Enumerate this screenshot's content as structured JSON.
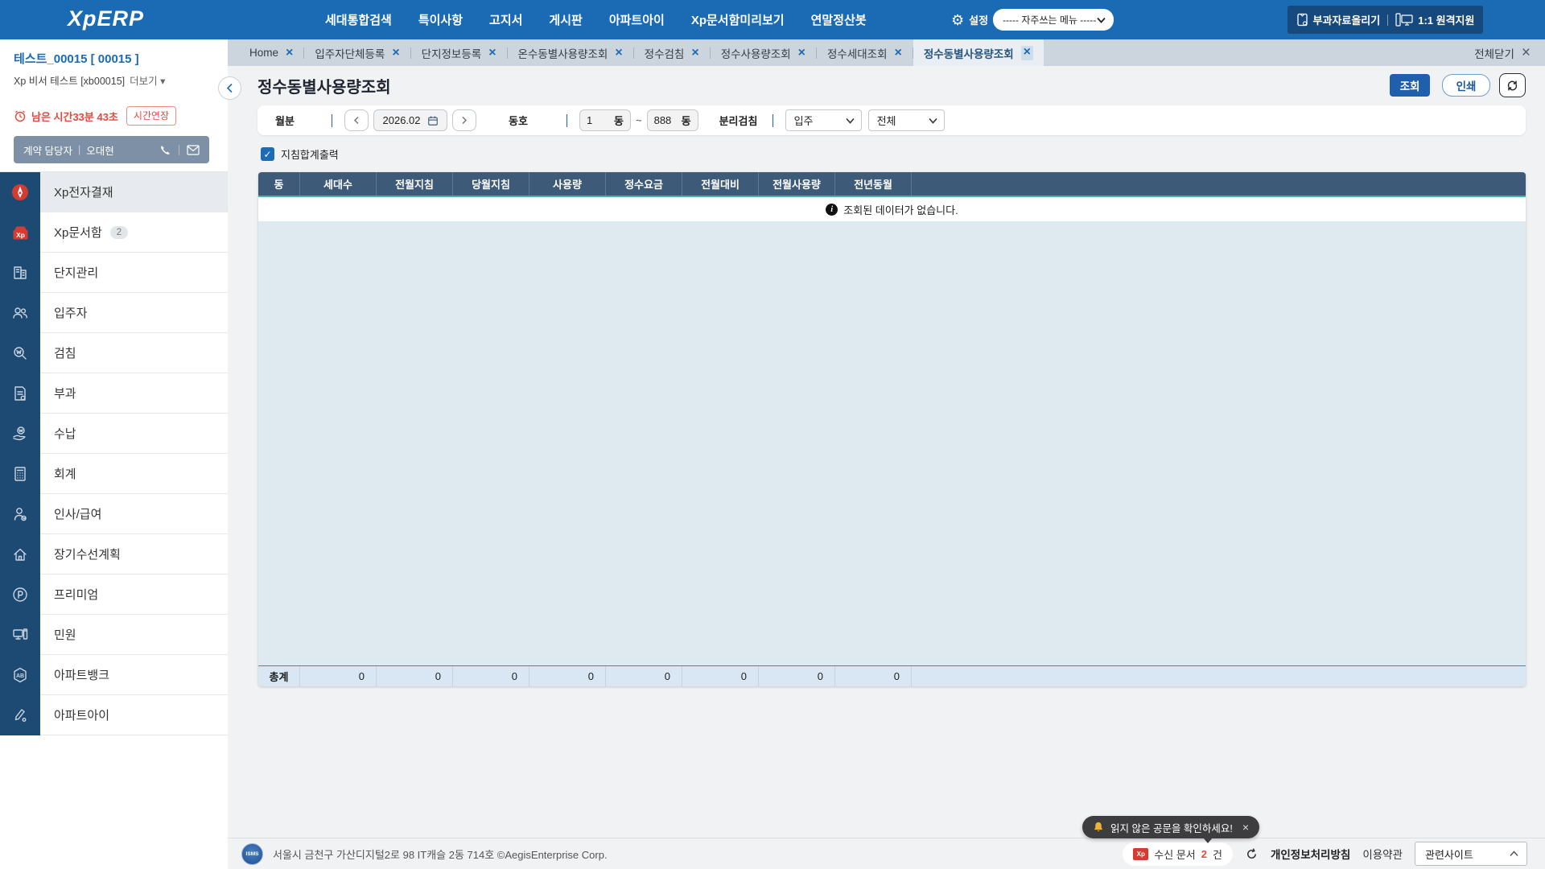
{
  "navbar": {
    "logo": "XpERP",
    "menu": [
      "세대통합검색",
      "특이사항",
      "고지서",
      "게시판",
      "아파트아이",
      "Xp문서함미리보기",
      "연말정산봇"
    ],
    "settings_label": "설정",
    "favorites_select": "----- 자주쓰는 메뉴 -----",
    "upload_label": "부과자료올리기",
    "remote_label": "1:1 원격지원"
  },
  "sidebar": {
    "site_title": "테스트_00015 [ 00015 ]",
    "site_subtitle": "Xp 비서 테스트 [xb00015]",
    "more_label": "더보기 ▾",
    "timer_label": "남은 시간33분 43초",
    "extend_label": "시간연장",
    "contact_role": "계약 담당자",
    "contact_divider": "|",
    "contact_name": "오대현",
    "menu": [
      {
        "label": "Xp전자결재"
      },
      {
        "label": "Xp문서함",
        "badge": "2"
      },
      {
        "label": "단지관리"
      },
      {
        "label": "입주자"
      },
      {
        "label": "검침"
      },
      {
        "label": "부과"
      },
      {
        "label": "수납"
      },
      {
        "label": "회계"
      },
      {
        "label": "인사/급여"
      },
      {
        "label": "장기수선계획"
      },
      {
        "label": "프리미엄"
      },
      {
        "label": "민원"
      },
      {
        "label": "아파트뱅크"
      },
      {
        "label": "아파트아이"
      }
    ]
  },
  "tabs": {
    "items": [
      {
        "label": "Home"
      },
      {
        "label": "입주자단체등록"
      },
      {
        "label": "단지정보등록"
      },
      {
        "label": "온수동별사용량조회"
      },
      {
        "label": "정수검침"
      },
      {
        "label": "정수사용량조회"
      },
      {
        "label": "정수세대조회"
      },
      {
        "label": "정수동별사용량조회"
      }
    ],
    "close_all_label": "전체닫기"
  },
  "page": {
    "title": "정수동별사용량조회",
    "search_button": "조회",
    "print_button": "인쇄"
  },
  "filters": {
    "month_label": "월분",
    "month_value": "2026.02",
    "dong_label": "동호",
    "dong_from": "1",
    "dong_to": "888",
    "dong_suffix": "동",
    "range_tilde": "~",
    "split_label": "분리검침",
    "select_occupancy": "입주",
    "select_all": "전체",
    "checkbox_label": "지침합계출력",
    "checkbox_checked": "✓"
  },
  "table": {
    "headers": [
      "동",
      "세대수",
      "전월지침",
      "당월지침",
      "사용량",
      "정수요금",
      "전월대비",
      "전월사용량",
      "전년동월"
    ],
    "empty_message": "조회된 데이터가 없습니다.",
    "info_glyph": "i",
    "total_label": "총계",
    "total_values": [
      "0",
      "0",
      "0",
      "0",
      "0",
      "0",
      "0",
      "0"
    ]
  },
  "footer": {
    "badge_text": "ISMS",
    "address": "서울시 금천구 가산디지털2로 98 IT캐슬 2동 714호 ©AegisEnterprise Corp.",
    "toast_message": "읽지 않은 공문을 확인하세요!",
    "inbox_icon_text": "Xp",
    "inbox_prefix": "수신 문서",
    "inbox_count": "2",
    "inbox_suffix": "건",
    "privacy_label": "개인정보처리방침",
    "terms_label": "이용약관",
    "related_select": "관련사이트"
  },
  "colors": {
    "accent_blue": "#1b6bb4",
    "header_navy": "#3d5a78",
    "teal_accent": "#43b3b0",
    "alert_red": "#e5483f"
  }
}
